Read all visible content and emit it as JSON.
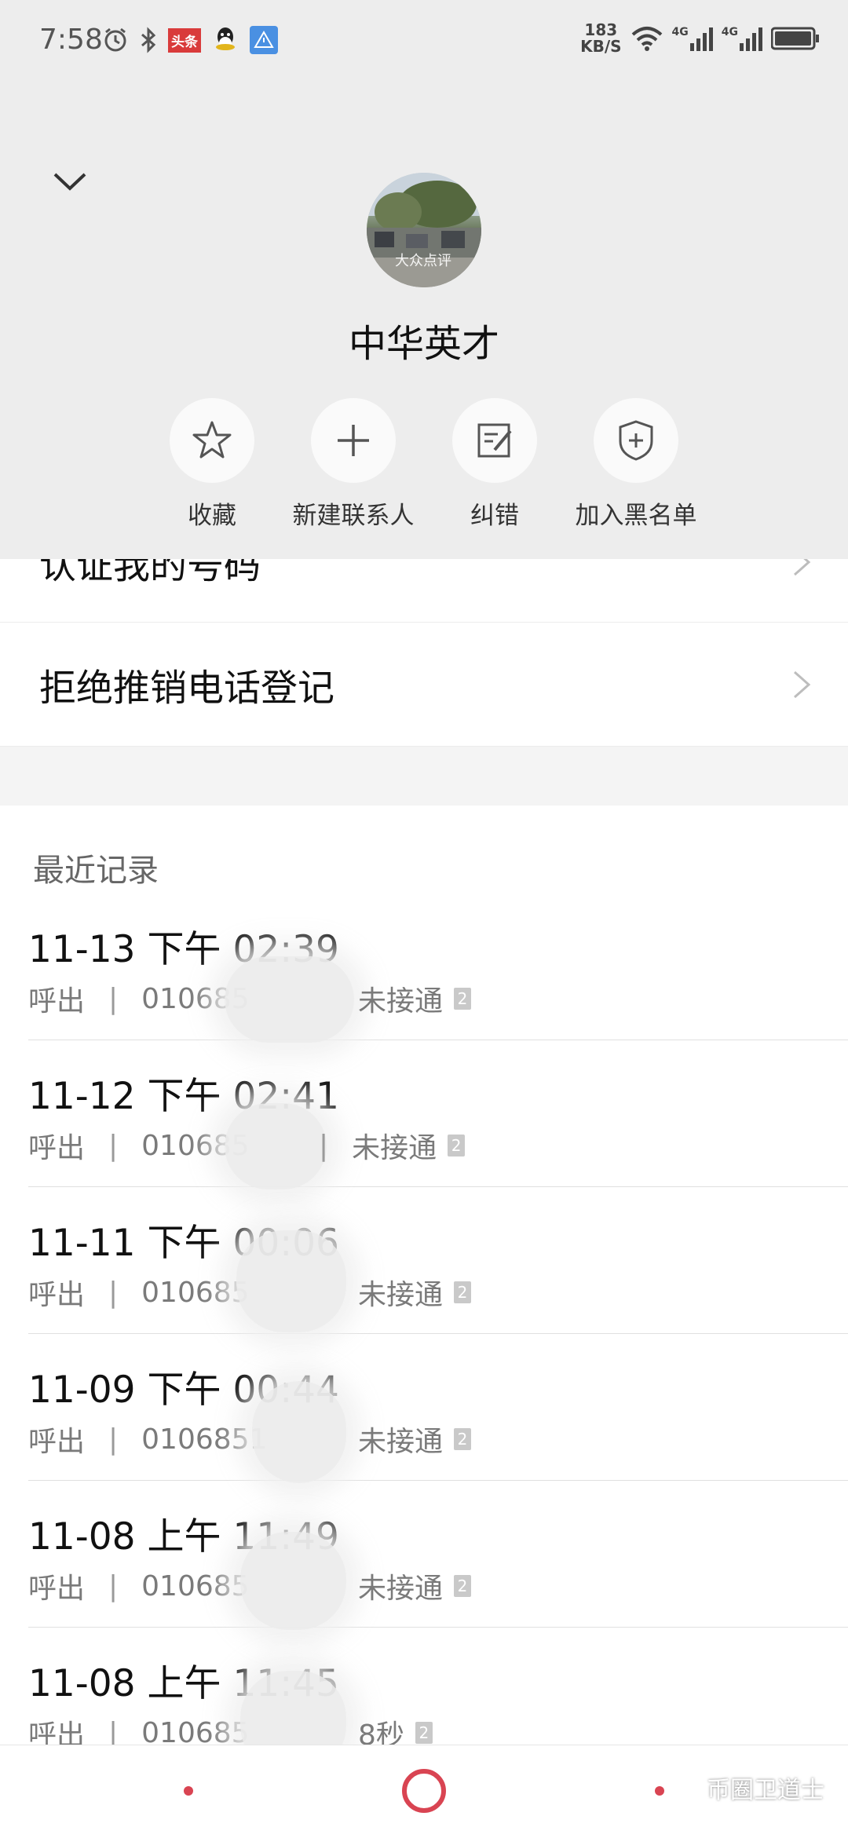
{
  "status_bar": {
    "time": "7:58",
    "speed_value": "183",
    "speed_unit": "KB/S",
    "network1": "4G",
    "network2": "4G",
    "news_badge": "头条"
  },
  "contact": {
    "name": "中华英才",
    "avatar_watermark": "大众点评"
  },
  "actions": [
    {
      "label": "收藏",
      "icon": "star-icon"
    },
    {
      "label": "新建联系人",
      "icon": "plus-icon"
    },
    {
      "label": "纠错",
      "icon": "edit-icon"
    },
    {
      "label": "加入黑名单",
      "icon": "shield-plus-icon"
    }
  ],
  "menu": {
    "verify_number": "认证我的号码",
    "refuse_telemarketing": "拒绝推销电话登记"
  },
  "recent": {
    "title": "最近记录",
    "records": [
      {
        "time": "11-13 下午 02:39",
        "direction": "呼出",
        "number": "010685",
        "status": "未接通",
        "sim": "2"
      },
      {
        "time": "11-12 下午 02:41",
        "direction": "呼出",
        "number": "010685",
        "status": "未接通",
        "sim": "2"
      },
      {
        "time": "11-11 下午 00:06",
        "direction": "呼出",
        "number": "010685",
        "status": "未接通",
        "sim": "2"
      },
      {
        "time": "11-09 下午 00:44",
        "direction": "呼出",
        "number": "0106851",
        "status": "未接通",
        "sim": "2"
      },
      {
        "time": "11-08 上午 11:49",
        "direction": "呼出",
        "number": "010685",
        "status": "未接通",
        "sim": "2"
      },
      {
        "time": "11-08 上午 11:45",
        "direction": "呼出",
        "number": "010685",
        "status": "8秒",
        "sim": "2"
      }
    ]
  },
  "watermark": "币圈卫道士",
  "colors": {
    "accent": "#d94452",
    "header_bg": "#ededed"
  }
}
